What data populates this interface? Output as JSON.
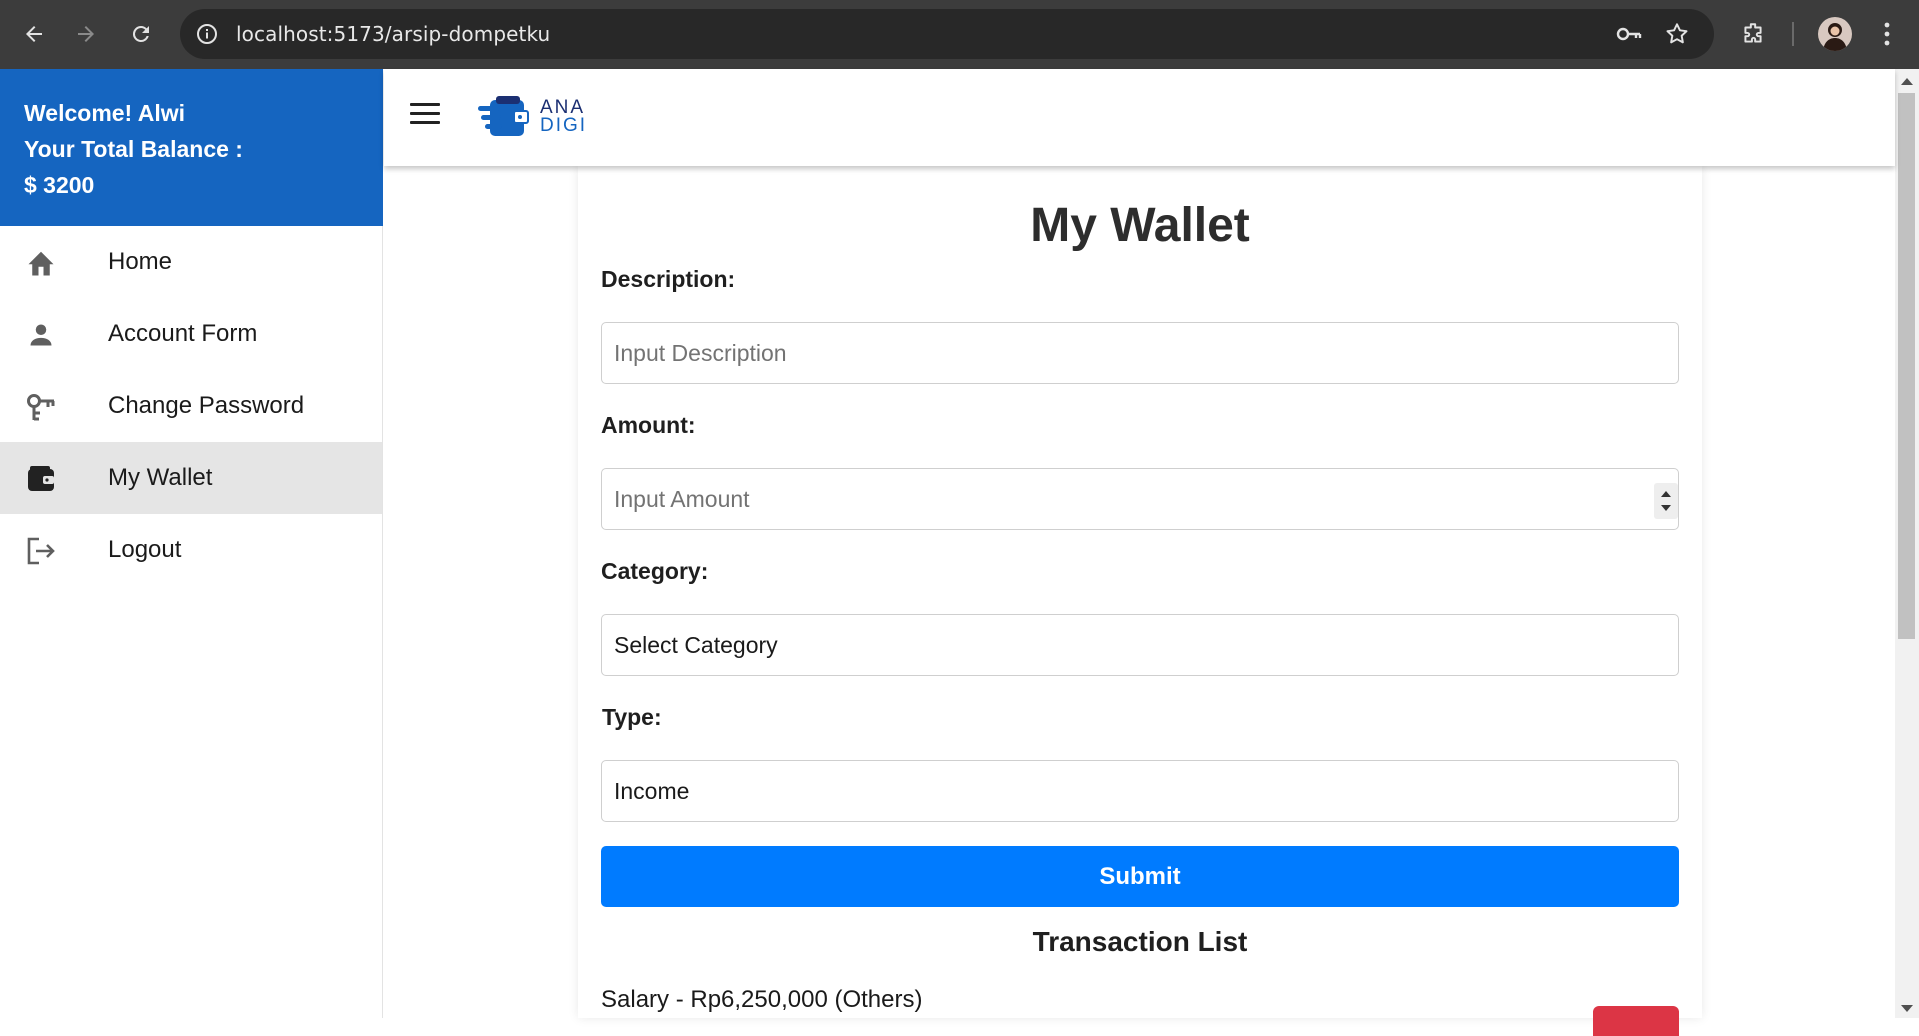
{
  "browser": {
    "url": "localhost:5173/arsip-dompetku"
  },
  "sidebar": {
    "welcome_line": "Welcome! Alwi",
    "balance_label": "Your Total Balance :",
    "balance_value": "$ 3200",
    "items": [
      {
        "label": "Home",
        "icon": "home-icon"
      },
      {
        "label": "Account Form",
        "icon": "person-icon"
      },
      {
        "label": "Change Password",
        "icon": "key-icon"
      },
      {
        "label": "My Wallet",
        "icon": "wallet-icon",
        "active": true
      },
      {
        "label": "Logout",
        "icon": "logout-icon"
      }
    ]
  },
  "header": {
    "logo_line1": "ANA",
    "logo_line2": "DIGI",
    "logo_color": "#1565c0"
  },
  "form": {
    "title": "My Wallet",
    "description_label": "Description:",
    "description_placeholder": "Input Description",
    "amount_label": "Amount:",
    "amount_placeholder": "Input Amount",
    "category_label": "Category:",
    "category_value": "Select Category",
    "type_label": "Type:",
    "type_value": "Income",
    "submit_label": "Submit",
    "submit_color": "#007bff"
  },
  "transactions": {
    "title": "Transaction List",
    "items": [
      {
        "text": "Salary - Rp6,250,000 (Others)"
      }
    ],
    "delete_color": "#dc3545"
  }
}
